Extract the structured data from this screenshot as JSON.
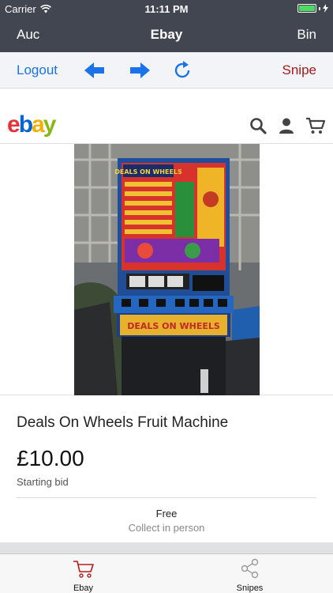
{
  "status_bar": {
    "carrier": "Carrier",
    "time": "11:11 PM"
  },
  "nav": {
    "left": "Auc",
    "title": "Ebay",
    "right": "Bin"
  },
  "toolbar": {
    "logout": "Logout",
    "snipe": "Snipe"
  },
  "ebay_header": {
    "logo_letters": [
      "e",
      "b",
      "a",
      "y"
    ]
  },
  "listing": {
    "title": "Deals On Wheels Fruit Machine",
    "price": "£10.00",
    "price_label": "Starting bid",
    "shipping": "Free",
    "pickup": "Collect in person"
  },
  "tabs": [
    {
      "label": "Ebay",
      "icon": "cart-icon",
      "active": true
    },
    {
      "label": "Snipes",
      "icon": "share-icon",
      "active": false
    }
  ],
  "colors": {
    "navbar_bg": "#414650",
    "toolbar_link": "#1a73e8",
    "snipe": "#a11b1b",
    "battery": "#4cd964"
  }
}
